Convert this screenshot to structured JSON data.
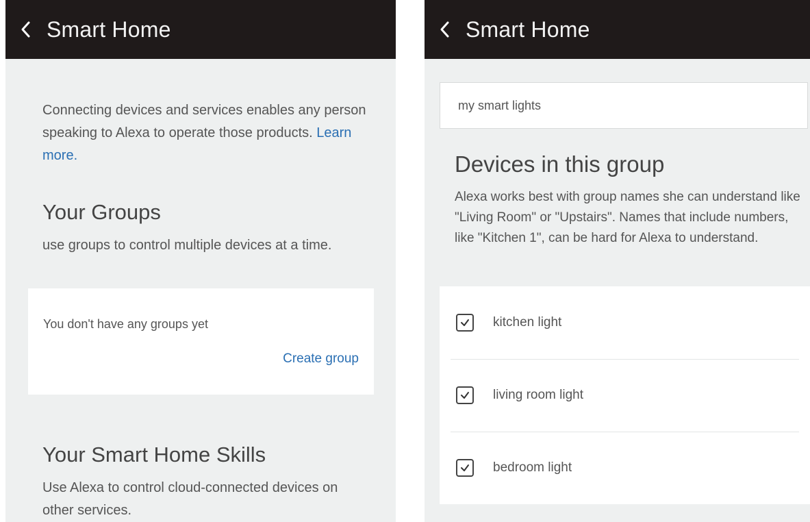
{
  "left": {
    "header": {
      "title": "Smart Home"
    },
    "intro": {
      "text": "Connecting devices and services enables any person speaking to Alexa to operate those products.",
      "link": "Learn more."
    },
    "groups": {
      "title": "Your Groups",
      "description": "use groups to control multiple devices at a time.",
      "empty_text": "You don't have any groups yet",
      "create_label": "Create group"
    },
    "skills": {
      "title": "Your Smart Home Skills",
      "description": "Use Alexa to control cloud-connected devices on other services."
    }
  },
  "right": {
    "header": {
      "title": "Smart Home"
    },
    "group_name_value": "my smart lights",
    "devices_section": {
      "title": "Devices in this group",
      "description": "Alexa works best with group names she can understand like \"Living Room\" or \"Upstairs\". Names that include numbers, like \"Kitchen 1\", can be hard for Alexa to understand."
    },
    "devices": [
      {
        "label": "kitchen light",
        "checked": true
      },
      {
        "label": "living room light",
        "checked": true
      },
      {
        "label": "bedroom light",
        "checked": true
      }
    ]
  },
  "icons": {
    "back": "chevron-left-icon",
    "checkbox": "checkmark-icon"
  },
  "colors": {
    "header_bg": "#1f1a1a",
    "link": "#2a6fb3",
    "background": "#eef0f0"
  }
}
